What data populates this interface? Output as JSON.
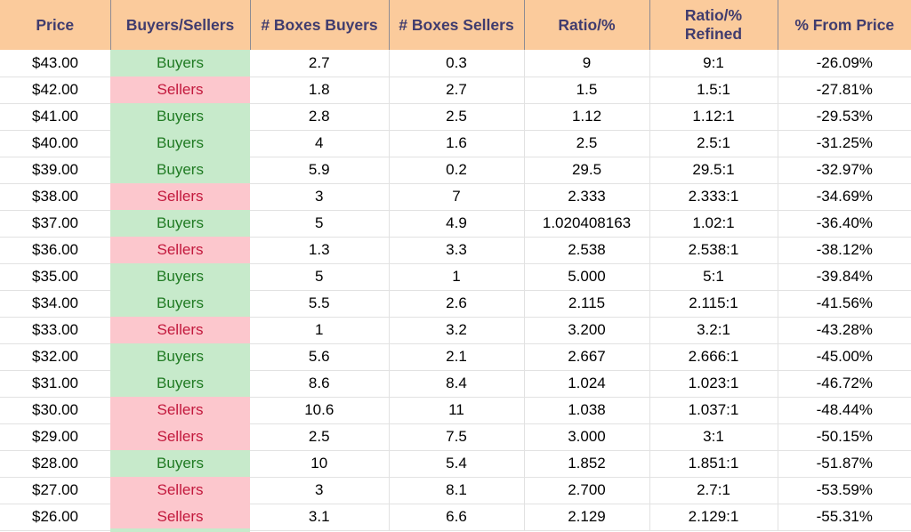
{
  "table": {
    "columns": [
      {
        "key": "price",
        "label": "Price"
      },
      {
        "key": "buyers_sellers",
        "label": "Buyers/Sellers"
      },
      {
        "key": "boxes_buyers",
        "label": "# Boxes Buyers"
      },
      {
        "key": "boxes_sellers",
        "label": "# Boxes Sellers"
      },
      {
        "key": "ratio",
        "label": "Ratio/%"
      },
      {
        "key": "ratio_refined",
        "label": "Ratio/%\nRefined"
      },
      {
        "key": "pct_from_price",
        "label": "% From Price"
      }
    ],
    "column_labels": {
      "price": "Price",
      "buyers_sellers": "Buyers/Sellers",
      "boxes_buyers": "# Boxes Buyers",
      "boxes_sellers": "# Boxes Sellers",
      "ratio": "Ratio/%",
      "ratio_refined_line1": "Ratio/%",
      "ratio_refined_line2": "Refined",
      "pct_from_price": "% From Price"
    },
    "rows": [
      {
        "price": "$43.00",
        "side": "Buyers",
        "boxes_buyers": "2.7",
        "boxes_sellers": "0.3",
        "ratio": "9",
        "ratio_refined": "9:1",
        "pct_from_price": "-26.09%"
      },
      {
        "price": "$42.00",
        "side": "Sellers",
        "boxes_buyers": "1.8",
        "boxes_sellers": "2.7",
        "ratio": "1.5",
        "ratio_refined": "1.5:1",
        "pct_from_price": "-27.81%"
      },
      {
        "price": "$41.00",
        "side": "Buyers",
        "boxes_buyers": "2.8",
        "boxes_sellers": "2.5",
        "ratio": "1.12",
        "ratio_refined": "1.12:1",
        "pct_from_price": "-29.53%"
      },
      {
        "price": "$40.00",
        "side": "Buyers",
        "boxes_buyers": "4",
        "boxes_sellers": "1.6",
        "ratio": "2.5",
        "ratio_refined": "2.5:1",
        "pct_from_price": "-31.25%"
      },
      {
        "price": "$39.00",
        "side": "Buyers",
        "boxes_buyers": "5.9",
        "boxes_sellers": "0.2",
        "ratio": "29.5",
        "ratio_refined": "29.5:1",
        "pct_from_price": "-32.97%"
      },
      {
        "price": "$38.00",
        "side": "Sellers",
        "boxes_buyers": "3",
        "boxes_sellers": "7",
        "ratio": "2.333",
        "ratio_refined": "2.333:1",
        "pct_from_price": "-34.69%"
      },
      {
        "price": "$37.00",
        "side": "Buyers",
        "boxes_buyers": "5",
        "boxes_sellers": "4.9",
        "ratio": "1.020408163",
        "ratio_refined": "1.02:1",
        "pct_from_price": "-36.40%"
      },
      {
        "price": "$36.00",
        "side": "Sellers",
        "boxes_buyers": "1.3",
        "boxes_sellers": "3.3",
        "ratio": "2.538",
        "ratio_refined": "2.538:1",
        "pct_from_price": "-38.12%"
      },
      {
        "price": "$35.00",
        "side": "Buyers",
        "boxes_buyers": "5",
        "boxes_sellers": "1",
        "ratio": "5.000",
        "ratio_refined": "5:1",
        "pct_from_price": "-39.84%"
      },
      {
        "price": "$34.00",
        "side": "Buyers",
        "boxes_buyers": "5.5",
        "boxes_sellers": "2.6",
        "ratio": "2.115",
        "ratio_refined": "2.115:1",
        "pct_from_price": "-41.56%"
      },
      {
        "price": "$33.00",
        "side": "Sellers",
        "boxes_buyers": "1",
        "boxes_sellers": "3.2",
        "ratio": "3.200",
        "ratio_refined": "3.2:1",
        "pct_from_price": "-43.28%"
      },
      {
        "price": "$32.00",
        "side": "Buyers",
        "boxes_buyers": "5.6",
        "boxes_sellers": "2.1",
        "ratio": "2.667",
        "ratio_refined": "2.666:1",
        "pct_from_price": "-45.00%"
      },
      {
        "price": "$31.00",
        "side": "Buyers",
        "boxes_buyers": "8.6",
        "boxes_sellers": "8.4",
        "ratio": "1.024",
        "ratio_refined": "1.023:1",
        "pct_from_price": "-46.72%"
      },
      {
        "price": "$30.00",
        "side": "Sellers",
        "boxes_buyers": "10.6",
        "boxes_sellers": "11",
        "ratio": "1.038",
        "ratio_refined": "1.037:1",
        "pct_from_price": "-48.44%"
      },
      {
        "price": "$29.00",
        "side": "Sellers",
        "boxes_buyers": "2.5",
        "boxes_sellers": "7.5",
        "ratio": "3.000",
        "ratio_refined": "3:1",
        "pct_from_price": "-50.15%"
      },
      {
        "price": "$28.00",
        "side": "Buyers",
        "boxes_buyers": "10",
        "boxes_sellers": "5.4",
        "ratio": "1.852",
        "ratio_refined": "1.851:1",
        "pct_from_price": "-51.87%"
      },
      {
        "price": "$27.00",
        "side": "Sellers",
        "boxes_buyers": "3",
        "boxes_sellers": "8.1",
        "ratio": "2.700",
        "ratio_refined": "2.7:1",
        "pct_from_price": "-53.59%"
      },
      {
        "price": "$26.00",
        "side": "Sellers",
        "boxes_buyers": "3.1",
        "boxes_sellers": "6.6",
        "ratio": "2.129",
        "ratio_refined": "2.129:1",
        "pct_from_price": "-55.31%"
      }
    ],
    "partial_next_row_side": "Buyers"
  },
  "colors": {
    "header_background": "#fbcb9c",
    "header_text": "#403c6e",
    "buyers_background": "#c7eacb",
    "buyers_text": "#1f7a22",
    "sellers_background": "#fcc7cd",
    "sellers_text": "#c2183c",
    "grid_line": "#e2e2e2",
    "header_divider": "#8d8b93",
    "body_text": "#000000",
    "body_background": "#ffffff"
  }
}
